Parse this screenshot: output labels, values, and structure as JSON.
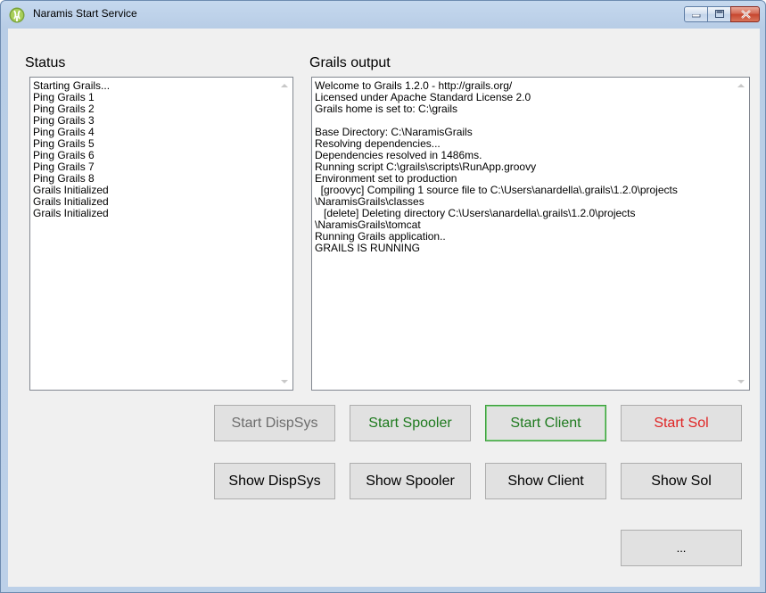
{
  "window": {
    "title": "Naramis Start Service",
    "icon": "grails-leaf-icon",
    "controls": [
      "minimize-icon",
      "maximize-icon",
      "close-icon"
    ]
  },
  "status": {
    "label": "Status",
    "lines": [
      "Starting Grails...",
      "Ping Grails 1",
      "Ping Grails 2",
      "Ping Grails 3",
      "Ping Grails 4",
      "Ping Grails 5",
      "Ping Grails 6",
      "Ping Grails 7",
      "Ping Grails 8",
      "Grails Initialized",
      "Grails Initialized",
      "Grails Initialized"
    ]
  },
  "output": {
    "label": "Grails output",
    "lines": [
      "Welcome to Grails 1.2.0 - http://grails.org/",
      "Licensed under Apache Standard License 2.0",
      "Grails home is set to: C:\\grails",
      "",
      "Base Directory: C:\\NaramisGrails",
      "Resolving dependencies...",
      "Dependencies resolved in 1486ms.",
      "Running script C:\\grails\\scripts\\RunApp.groovy",
      "Environment set to production",
      "  [groovyc] Compiling 1 source file to C:\\Users\\anardella\\.grails\\1.2.0\\projects",
      "\\NaramisGrails\\classes",
      "   [delete] Deleting directory C:\\Users\\anardella\\.grails\\1.2.0\\projects",
      "\\NaramisGrails\\tomcat",
      "Running Grails application..",
      "GRAILS IS RUNNING"
    ]
  },
  "buttons": {
    "start_dispsys": "Start DispSys",
    "start_spooler": "Start Spooler",
    "start_client": "Start Client",
    "start_sol": "Start Sol",
    "show_dispsys": "Show DispSys",
    "show_spooler": "Show Spooler",
    "show_client": "Show Client",
    "show_sol": "Show Sol",
    "more": "..."
  },
  "colors": {
    "disabled_text": "#6d6d6d",
    "green_text": "#1e7a1e",
    "red_text": "#e02424",
    "default_border": "#3c9d3c"
  }
}
